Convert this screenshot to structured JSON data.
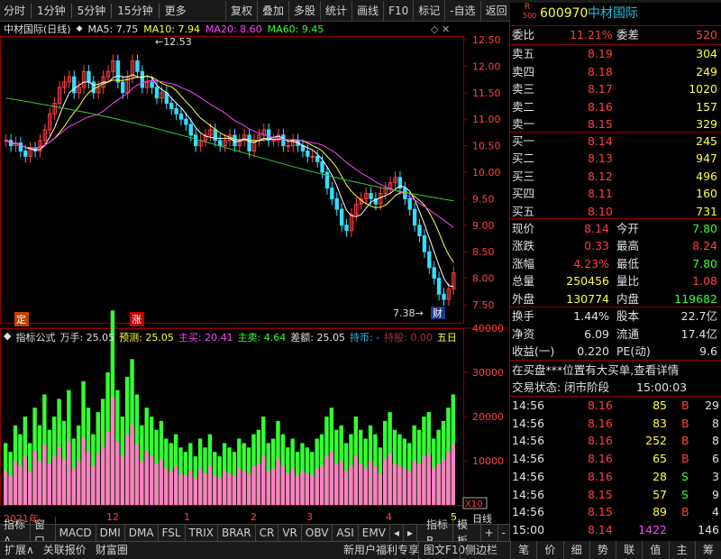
{
  "toolbar": {
    "periods": [
      "分时",
      "1分钟",
      "5分钟",
      "15分钟",
      "更多"
    ],
    "buttons": [
      "复权",
      "叠加",
      "多股",
      "统计",
      "画线",
      "F10",
      "标记",
      "-自选",
      "返回"
    ]
  },
  "legend": {
    "title": "中材国际(日线)",
    "ma5": "MA5: 7.75",
    "ma10": "MA10: 7.94",
    "ma20": "MA20: 8.60",
    "ma60": "MA60: 9.45"
  },
  "price_axis": [
    "12.50",
    "12.00",
    "11.50",
    "11.00",
    "10.50",
    "10.00",
    "9.50",
    "9.00",
    "8.50",
    "8.00",
    "7.50"
  ],
  "annotations": {
    "high": "12.53",
    "low": "7.38",
    "low_tag": "财",
    "tag_ding": "定",
    "tag_zhang": "涨"
  },
  "indicator": {
    "name": "指标公式",
    "wanshou": "万手: 25.05",
    "yuce": "预测: 25.05",
    "zhumai": "主买: 20.41",
    "zhumai2": "主卖: 4.64",
    "chae": "差额: 25.05",
    "chibi": "持币: -",
    "chigu": "持股: 0.00",
    "wuri": "五日"
  },
  "vol_axis": [
    "40000",
    "30000",
    "20000",
    "10000"
  ],
  "vol_unit": "X10",
  "date_axis": [
    "2021年",
    "12",
    "1",
    "2",
    "3",
    "4",
    "5"
  ],
  "date_axis_right": "日线",
  "bottom_tabs": [
    "指标A",
    "窗口",
    "MACD",
    "DMI",
    "DMA",
    "FSL",
    "TRIX",
    "BRAR",
    "CR",
    "VR",
    "OBV",
    "ASI",
    "EMV",
    "◂",
    "▸",
    "指标B",
    "模 板",
    "+",
    "-"
  ],
  "bottom_bar": [
    "扩展∧",
    "关联报价",
    "财富圈"
  ],
  "bottom_bar_right": [
    "新用户福利专享",
    "图文F10",
    "侧边栏"
  ],
  "keyboard": [
    "笔",
    "价",
    "细",
    "势",
    "联",
    "值",
    "主",
    "筹"
  ],
  "stock": {
    "code": "600970",
    "name": "中材国际",
    "r": "R",
    "num": "500"
  },
  "weibi": {
    "label": "委比",
    "value": "11.21%",
    "label2": "委差",
    "value2": "520"
  },
  "asks": [
    {
      "label": "卖五",
      "price": "8.19",
      "vol": "304"
    },
    {
      "label": "卖四",
      "price": "8.18",
      "vol": "249"
    },
    {
      "label": "卖三",
      "price": "8.17",
      "vol": "1020"
    },
    {
      "label": "卖二",
      "price": "8.16",
      "vol": "157"
    },
    {
      "label": "卖一",
      "price": "8.15",
      "vol": "329"
    }
  ],
  "bids": [
    {
      "label": "买一",
      "price": "8.14",
      "vol": "245"
    },
    {
      "label": "买二",
      "price": "8.13",
      "vol": "947"
    },
    {
      "label": "买三",
      "price": "8.12",
      "vol": "496"
    },
    {
      "label": "买四",
      "price": "8.11",
      "vol": "160"
    },
    {
      "label": "买五",
      "price": "8.10",
      "vol": "731"
    }
  ],
  "quote": [
    {
      "l1": "现价",
      "v1": "8.14",
      "l2": "今开",
      "v2": "7.80"
    },
    {
      "l1": "涨跌",
      "v1": "0.33",
      "l2": "最高",
      "v2": "8.24"
    },
    {
      "l1": "涨幅",
      "v1": "4.23%",
      "l2": "最低",
      "v2": "7.80"
    },
    {
      "l1": "总量",
      "v1": "250456",
      "l2": "量比",
      "v2": "1.08"
    },
    {
      "l1": "外盘",
      "v1": "130774",
      "l2": "内盘",
      "v2": "119682"
    }
  ],
  "fund": [
    {
      "l1": "换手",
      "v1": "1.44%",
      "l2": "股本",
      "v2": "22.7亿"
    },
    {
      "l1": "净资",
      "v1": "6.09",
      "l2": "流通",
      "v2": "17.4亿"
    },
    {
      "l1": "收益(一)",
      "v1": "0.220",
      "l2": "PE(动)",
      "v2": "9.6"
    }
  ],
  "notice": "在买盘***位置有大买单,查看详情",
  "status": {
    "label": "交易状态: 闭市阶段",
    "time": "15:00:03"
  },
  "ticks": [
    {
      "t": "14:56",
      "p": "8.16",
      "v": "85",
      "s": "B",
      "n": "29"
    },
    {
      "t": "14:56",
      "p": "8.16",
      "v": "83",
      "s": "B",
      "n": "8"
    },
    {
      "t": "14:56",
      "p": "8.16",
      "v": "252",
      "s": "B",
      "n": "8"
    },
    {
      "t": "14:56",
      "p": "8.16",
      "v": "65",
      "s": "B",
      "n": "6"
    },
    {
      "t": "14:56",
      "p": "8.16",
      "v": "28",
      "s": "S",
      "n": "3"
    },
    {
      "t": "14:56",
      "p": "8.15",
      "v": "57",
      "s": "S",
      "n": "9"
    },
    {
      "t": "14:56",
      "p": "8.15",
      "v": "89",
      "s": "B",
      "n": "4"
    },
    {
      "t": "15:00",
      "p": "8.14",
      "v": "1422",
      "s": "",
      "n": "146"
    }
  ],
  "colors": {
    "up": "#ff4040",
    "down": "#33ff33",
    "ma5": "#ffffff",
    "ma10": "#ffff40",
    "ma20": "#ff40ff",
    "ma60": "#33cc33",
    "grid": "#8b0000"
  }
}
